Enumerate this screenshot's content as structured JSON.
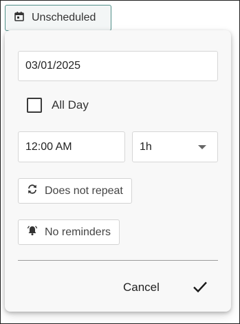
{
  "trigger": {
    "label": "Unscheduled",
    "icon": "calendar-icon"
  },
  "form": {
    "date_value": "03/01/2025",
    "all_day_label": "All Day",
    "all_day_checked": false,
    "time_value": "12:00 AM",
    "duration_value": "1h",
    "repeat_label": "Does not repeat",
    "repeat_icon": "repeat-icon",
    "reminder_label": "No reminders",
    "reminder_icon": "bell-icon"
  },
  "actions": {
    "cancel_label": "Cancel",
    "confirm_icon": "checkmark-icon"
  }
}
